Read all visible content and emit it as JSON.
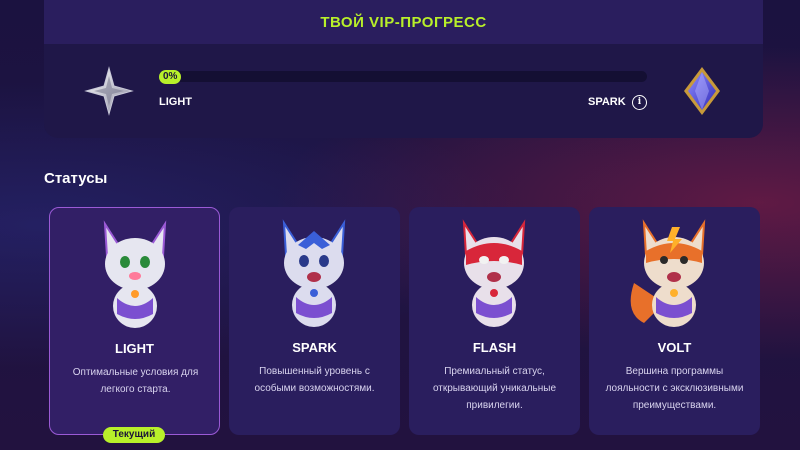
{
  "vip": {
    "title": "ТВОЙ VIP-ПРОГРЕСС",
    "progress_percent": 0,
    "progress_label": "0%",
    "current_level": "LIGHT",
    "next_level": "SPARK",
    "info_icon": "info-icon"
  },
  "statuses": {
    "title": "Статусы",
    "current_badge": "Текущий",
    "cards": [
      {
        "name": "LIGHT",
        "desc": "Оптимальные условия для легкого старта.",
        "color": "#e6e6f0"
      },
      {
        "name": "SPARK",
        "desc": "Повышенный уровень с особыми возможностями.",
        "color": "#3a5fd8"
      },
      {
        "name": "FLASH",
        "desc": "Премиальный статус, открывающий уникальные привилегии.",
        "color": "#d8263a"
      },
      {
        "name": "VOLT",
        "desc": "Вершина программы лояльности с эксклюзивными преимуществами.",
        "color": "#e8702a"
      }
    ]
  },
  "colors": {
    "accent": "#b8f02a",
    "panel": "#1f1748",
    "card": "#2a1e5e",
    "current_border": "#9b5ad6"
  }
}
